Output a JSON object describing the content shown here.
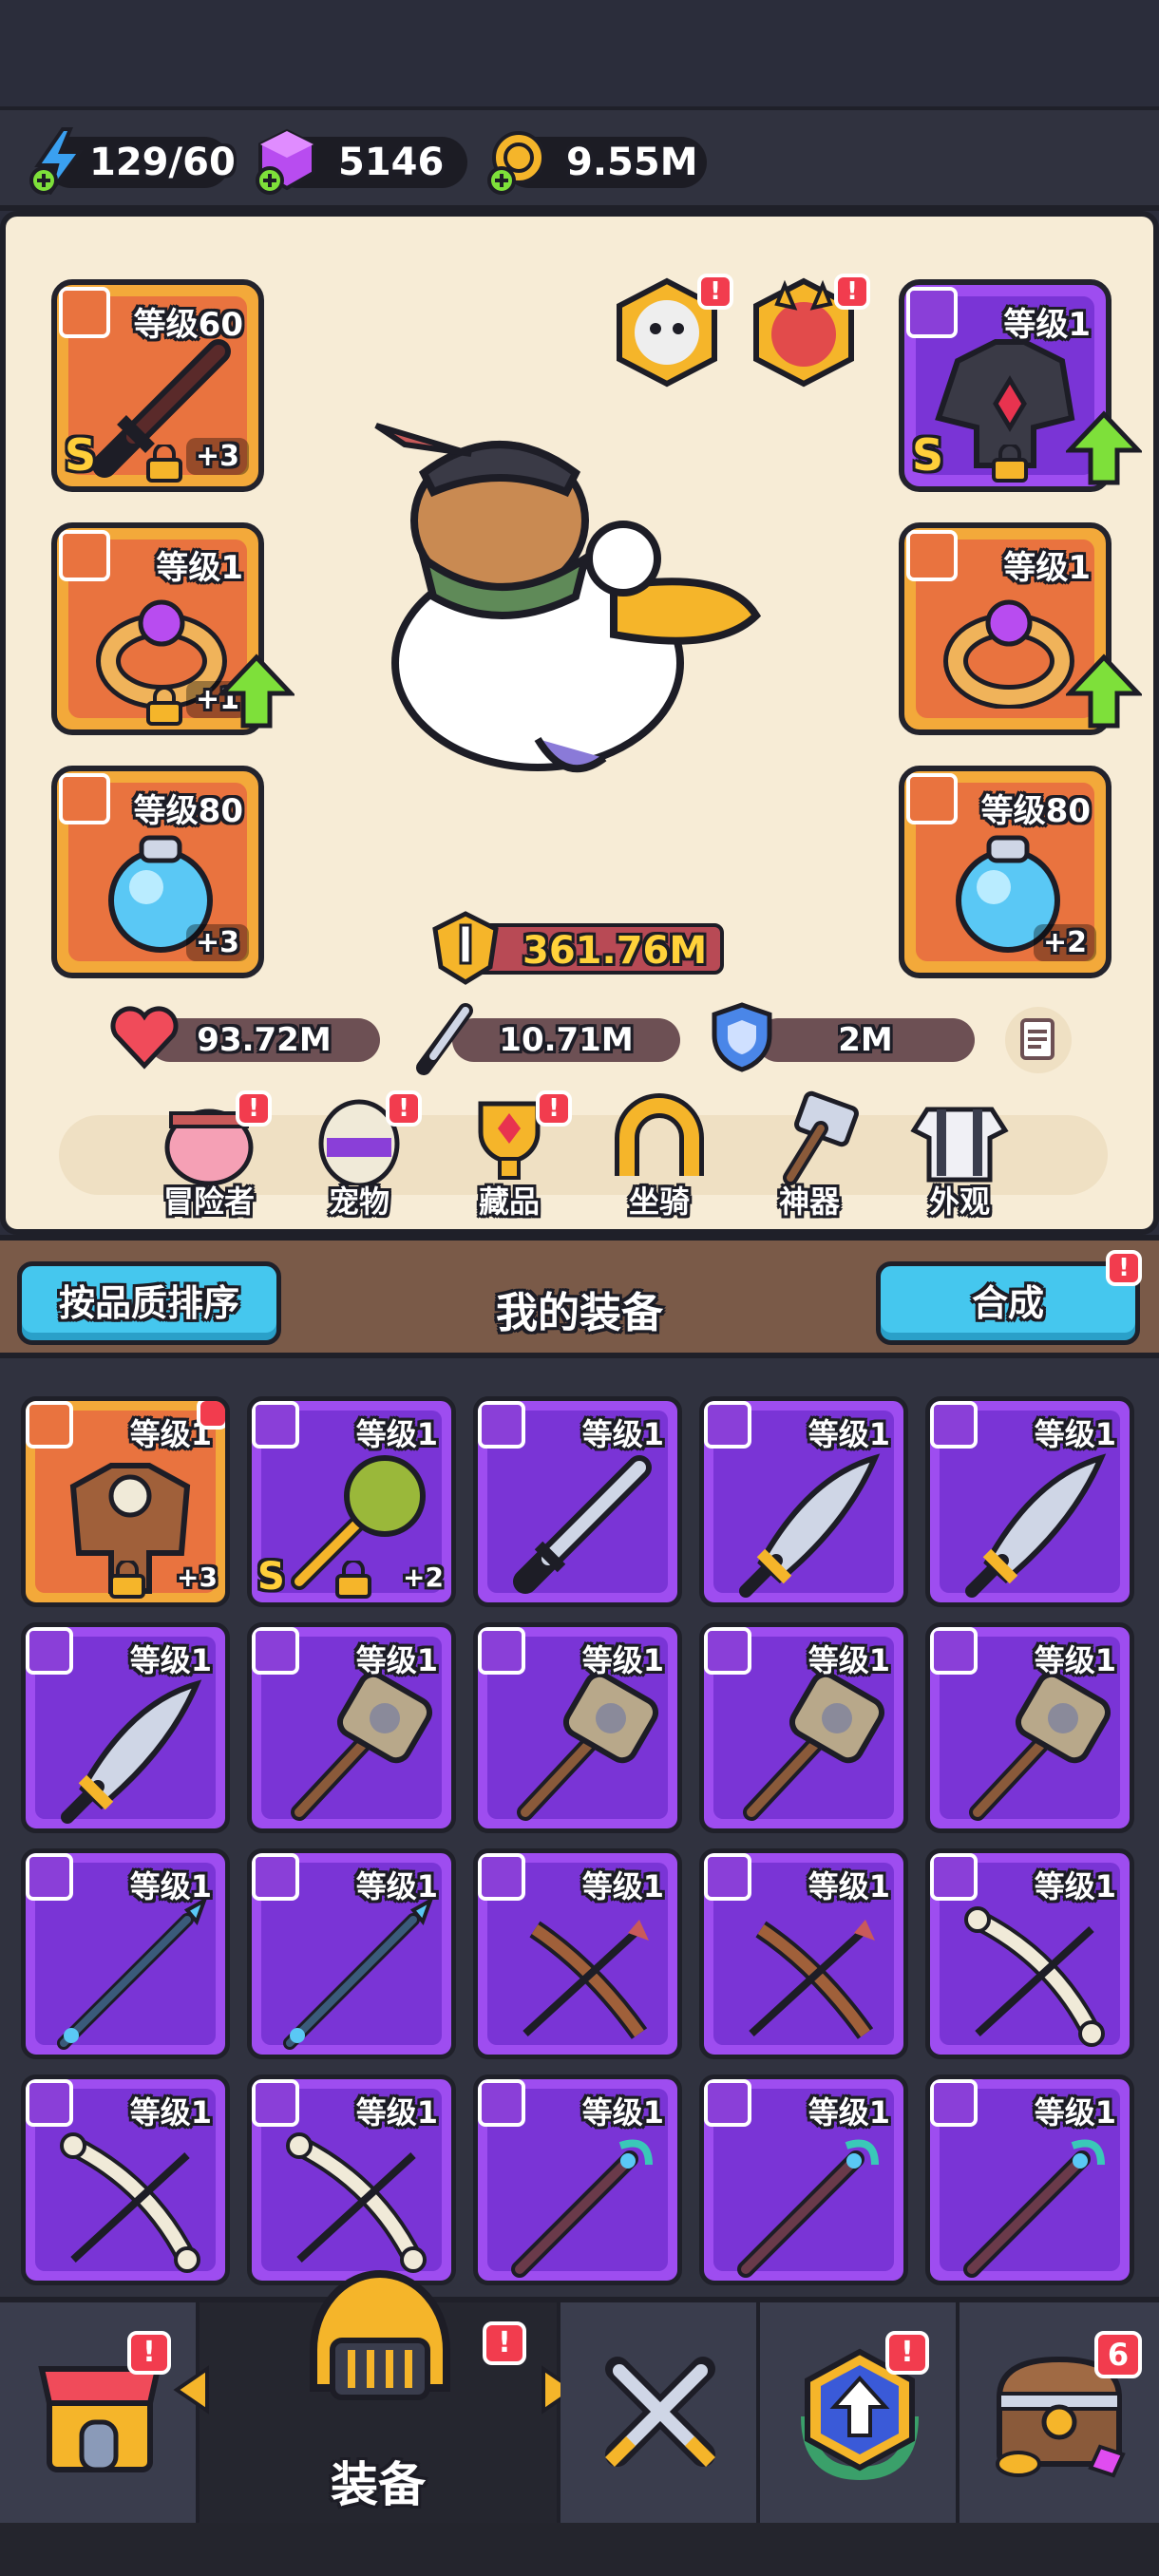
{
  "resources": {
    "energy": "129/60",
    "gems": "5146",
    "gold": "9.55M"
  },
  "slots": {
    "weapon": {
      "level": "等级60",
      "plus": "+3",
      "rarity": "S"
    },
    "ring_left": {
      "level": "等级1",
      "plus": "+1"
    },
    "amulet_left": {
      "level": "等级80",
      "plus": "+3"
    },
    "armor": {
      "level": "等级1",
      "rarity": "S"
    },
    "ring_right": {
      "level": "等级1"
    },
    "amulet_right": {
      "level": "等级80",
      "plus": "+2"
    }
  },
  "power": "361.76M",
  "stats": {
    "hp": "93.72M",
    "attack": "10.71M",
    "defense": "2M"
  },
  "nav": [
    {
      "label": "冒险者",
      "badge": "!"
    },
    {
      "label": "宠物",
      "badge": "!"
    },
    {
      "label": "藏品",
      "badge": "!"
    },
    {
      "label": "坐骑"
    },
    {
      "label": "神器"
    },
    {
      "label": "外观"
    }
  ],
  "equipment_header": {
    "sort_button": "按品质排序",
    "title": "我的装备",
    "merge_button": "合成",
    "merge_badge": "!"
  },
  "grid_items": [
    {
      "level": "等级1",
      "plus": "+3",
      "type": "armor",
      "orange": true
    },
    {
      "level": "等级1",
      "plus": "+2",
      "rarity": "S",
      "type": "mace"
    },
    {
      "level": "等级1",
      "type": "sword"
    },
    {
      "level": "等级1",
      "type": "saber"
    },
    {
      "level": "等级1",
      "type": "saber"
    },
    {
      "level": "等级1",
      "type": "saber"
    },
    {
      "level": "等级1",
      "type": "hammer"
    },
    {
      "level": "等级1",
      "type": "hammer"
    },
    {
      "level": "等级1",
      "type": "hammer"
    },
    {
      "level": "等级1",
      "type": "hammer"
    },
    {
      "level": "等级1",
      "type": "spear"
    },
    {
      "level": "等级1",
      "type": "spear"
    },
    {
      "level": "等级1",
      "type": "bow"
    },
    {
      "level": "等级1",
      "type": "bow"
    },
    {
      "level": "等级1",
      "type": "bonebow"
    },
    {
      "level": "等级1",
      "type": "bonebow"
    },
    {
      "level": "等级1",
      "type": "bonebow"
    },
    {
      "level": "等级1",
      "type": "staff"
    },
    {
      "level": "等级1",
      "type": "staff"
    },
    {
      "level": "等级1",
      "type": "staff"
    }
  ],
  "bottom_nav": {
    "active_label": "装备",
    "shop_badge": "!",
    "equip_badge": "!",
    "upgrade_badge": "!",
    "chest_badge": "6"
  }
}
